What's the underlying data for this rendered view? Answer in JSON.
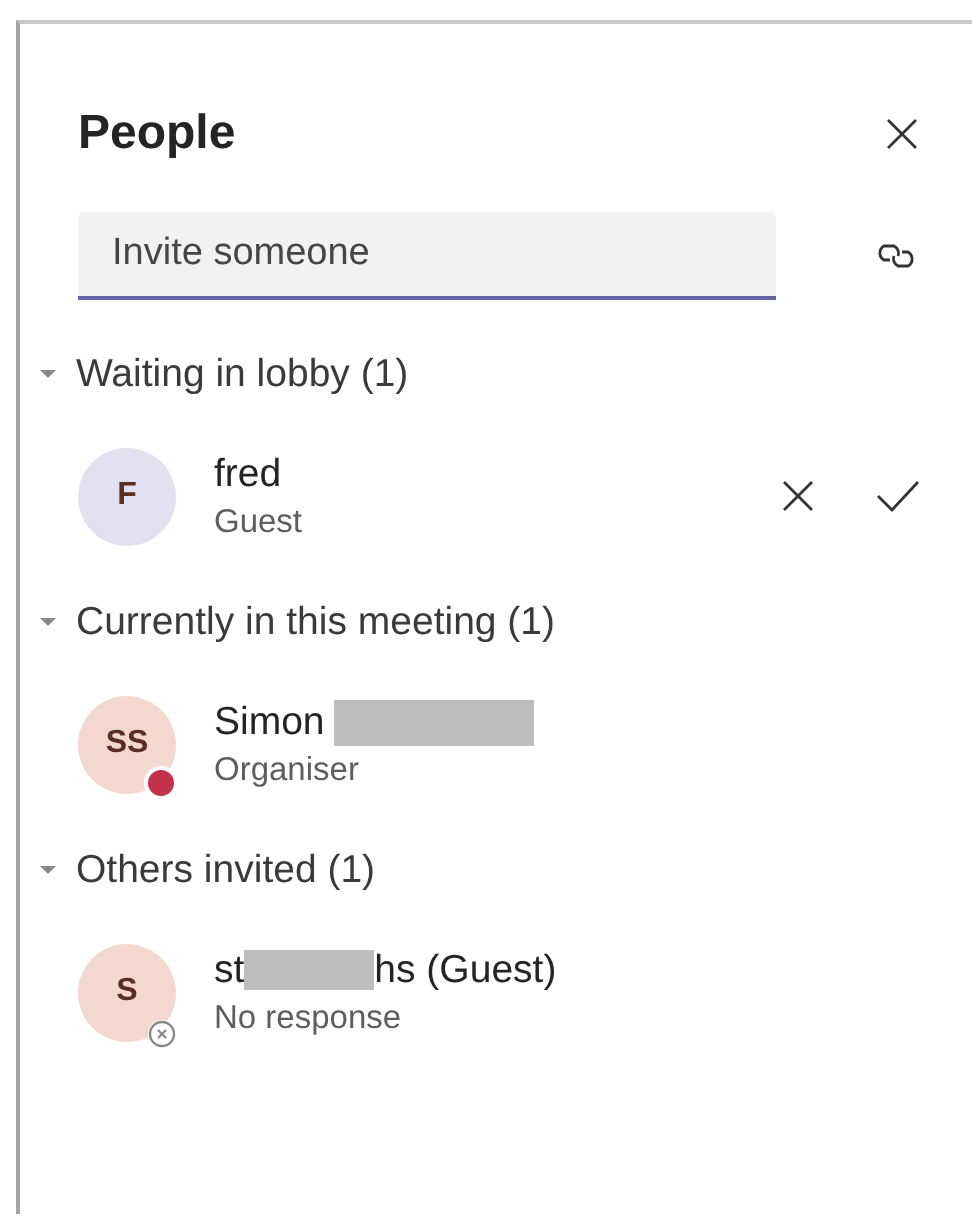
{
  "panel": {
    "title": "People"
  },
  "invite": {
    "placeholder": "Invite someone"
  },
  "sections": [
    {
      "header": "Waiting in lobby (1)",
      "expanded": true,
      "people": [
        {
          "initials": "F",
          "color": "#e3e0f1",
          "name_before": "fred",
          "redacted": false,
          "subtitle": "Guest",
          "kind": "plain",
          "actions": true
        }
      ]
    },
    {
      "header": "Currently in this meeting (1)",
      "expanded": true,
      "people": [
        {
          "initials": "SS",
          "color": "#f3d8d0",
          "name_before": "Simon",
          "redacted": true,
          "subtitle": "Organiser",
          "kind": "busy",
          "actions": false
        }
      ]
    },
    {
      "header": "Others invited (1)",
      "expanded": true,
      "people": [
        {
          "initials": "S",
          "color": "#f3d8d0",
          "name_before": "st",
          "redacted": true,
          "name_after": "hs (Guest)",
          "subtitle": "No response",
          "kind": "unknown",
          "actions": false
        }
      ]
    }
  ]
}
